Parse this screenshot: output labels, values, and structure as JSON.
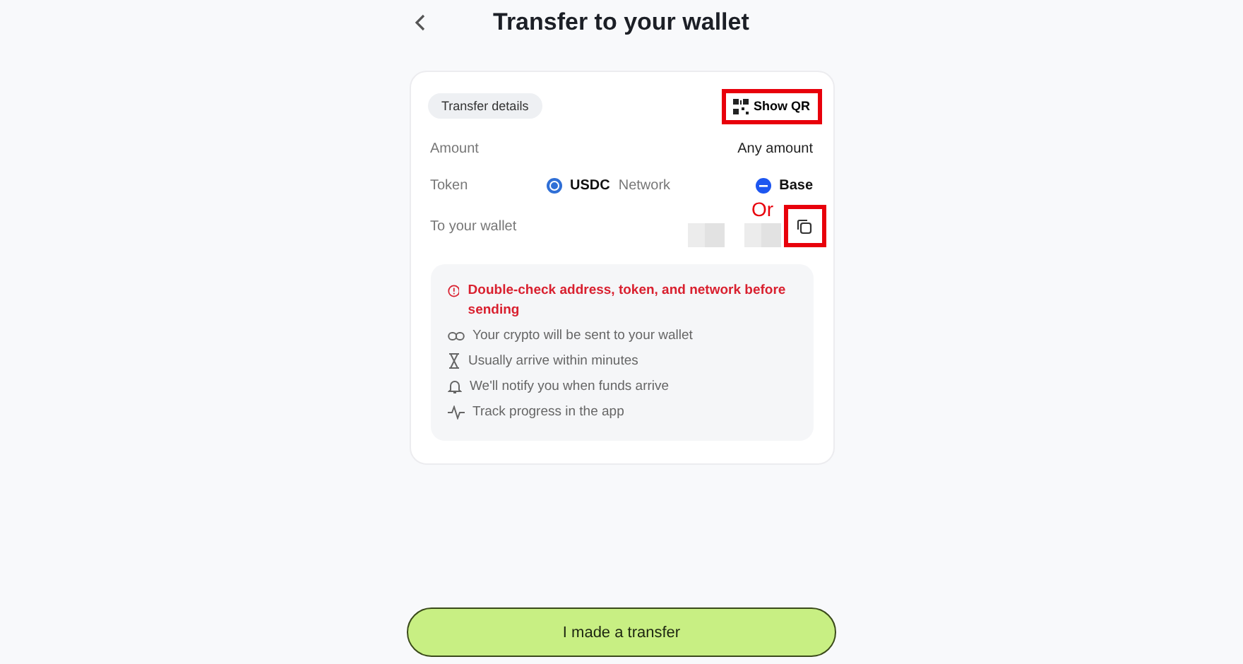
{
  "header": {
    "title": "Transfer to your wallet"
  },
  "card": {
    "badge": "Transfer details",
    "show_qr": {
      "label": "Show QR",
      "highlighted": true
    },
    "amount": {
      "label": "Amount",
      "value": "Any amount"
    },
    "token": {
      "label": "Token",
      "value": "USDC"
    },
    "network": {
      "label": "Network",
      "value": "Base"
    },
    "wallet": {
      "label": "To your wallet",
      "redacted": true,
      "copy_highlighted": true
    },
    "annotation": "Or",
    "notes": [
      {
        "kind": "warning",
        "text": "Double-check address, token, and network before sending"
      },
      {
        "kind": "info",
        "text": "Your crypto will be sent to your wallet"
      },
      {
        "kind": "info",
        "text": "Usually arrive within minutes"
      },
      {
        "kind": "info",
        "text": "We'll notify you when funds arrive"
      },
      {
        "kind": "info",
        "text": "Track progress in the app"
      }
    ]
  },
  "button": "I made a transfer"
}
